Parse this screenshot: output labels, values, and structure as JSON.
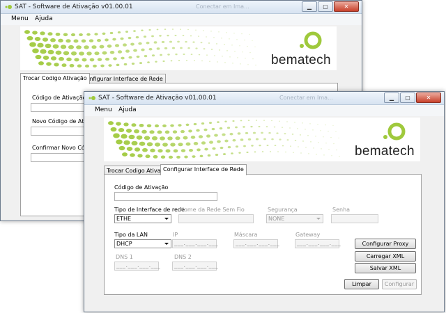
{
  "back_window": {
    "title": "SAT - Software de Ativação v01.00.01",
    "title_ghost": "Conectar em Ima...",
    "menu": [
      "Menu",
      "Ajuda"
    ],
    "logo": "bematech",
    "tabs": [
      "Trocar Codigo Ativação",
      "Configurar Interface de Rede"
    ],
    "labels": {
      "codigo": "Código de Ativação",
      "novo": "Novo Código de Ativa",
      "confirmar": "Confirmar Novo Código d"
    }
  },
  "front_window": {
    "title": "SAT - Software de Ativação v01.00.01",
    "title_ghost": "Conectar em Ima...",
    "menu": [
      "Menu",
      "Ajuda"
    ],
    "logo": "bematech",
    "tabs": [
      "Trocar Codigo Ativação",
      "Configurar Interface de Rede"
    ],
    "form": {
      "codigo_label": "Código de Ativação",
      "tipo_interface_label": "Tipo de Interface de rede",
      "tipo_interface_value": "ETHE",
      "nome_rede_label": "Nome da Rede Sem Fio",
      "seguranca_label": "Segurança",
      "seguranca_value": "NONE",
      "senha_label": "Senha",
      "tipo_lan_label": "Tipo da LAN",
      "tipo_lan_value": "DHCP",
      "ip_label": "IP",
      "mascara_label": "Máscara",
      "gateway_label": "Gateway",
      "dns1_label": "DNS 1",
      "dns2_label": "DNS 2",
      "ip_mask": "___.___.___.___"
    },
    "buttons": {
      "proxy": "Configurar Proxy",
      "carregar": "Carregar XML",
      "salvar": "Salvar XML",
      "limpar": "Limpar",
      "configurar": "Configurar"
    }
  },
  "colors": {
    "brand_green": "#9fc93c",
    "close_red": "#c8412b"
  }
}
